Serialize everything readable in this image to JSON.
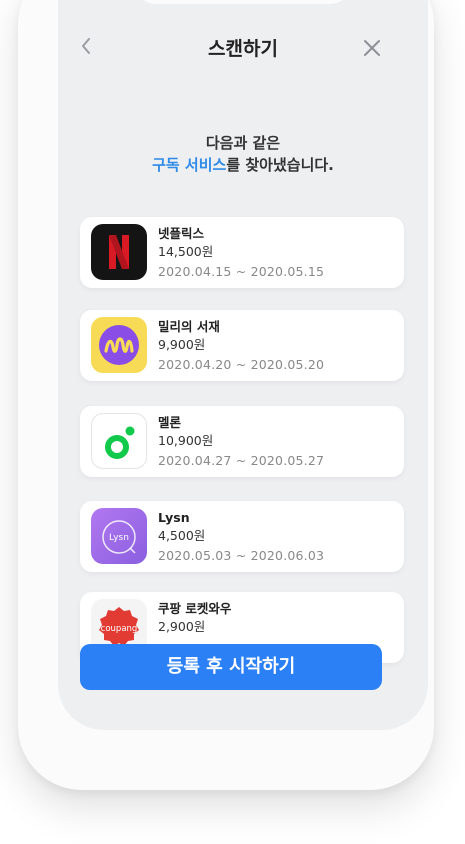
{
  "header": {
    "title": "스캔하기"
  },
  "headline": {
    "line1": "다음과 같은",
    "line2_accent": "구독 서비스",
    "line2_rest": "를 찾아냈습니다."
  },
  "subscriptions": [
    {
      "name": "넷플릭스",
      "price": "14,500원",
      "period": "2020.04.15 ~ 2020.05.15",
      "icon": "netflix-icon"
    },
    {
      "name": "밀리의 서재",
      "price": "9,900원",
      "period": "2020.04.20 ~ 2020.05.20",
      "icon": "millie-icon"
    },
    {
      "name": "멜론",
      "price": "10,900원",
      "period": "2020.04.27  ~ 2020.05.27",
      "icon": "melon-icon"
    },
    {
      "name": "Lysn",
      "price": "4,500원",
      "period": "2020.05.03  ~ 2020.06.03",
      "icon": "lysn-icon",
      "icon_text": "Lysn"
    },
    {
      "name": "쿠팡 로켓와우",
      "price": "2,900원",
      "icon": "coupang-icon",
      "icon_text": "coupang"
    }
  ],
  "cta": {
    "label": "등록 후 시작하기"
  },
  "colors": {
    "accent": "#2f8be8",
    "button": "#2b80f5"
  }
}
